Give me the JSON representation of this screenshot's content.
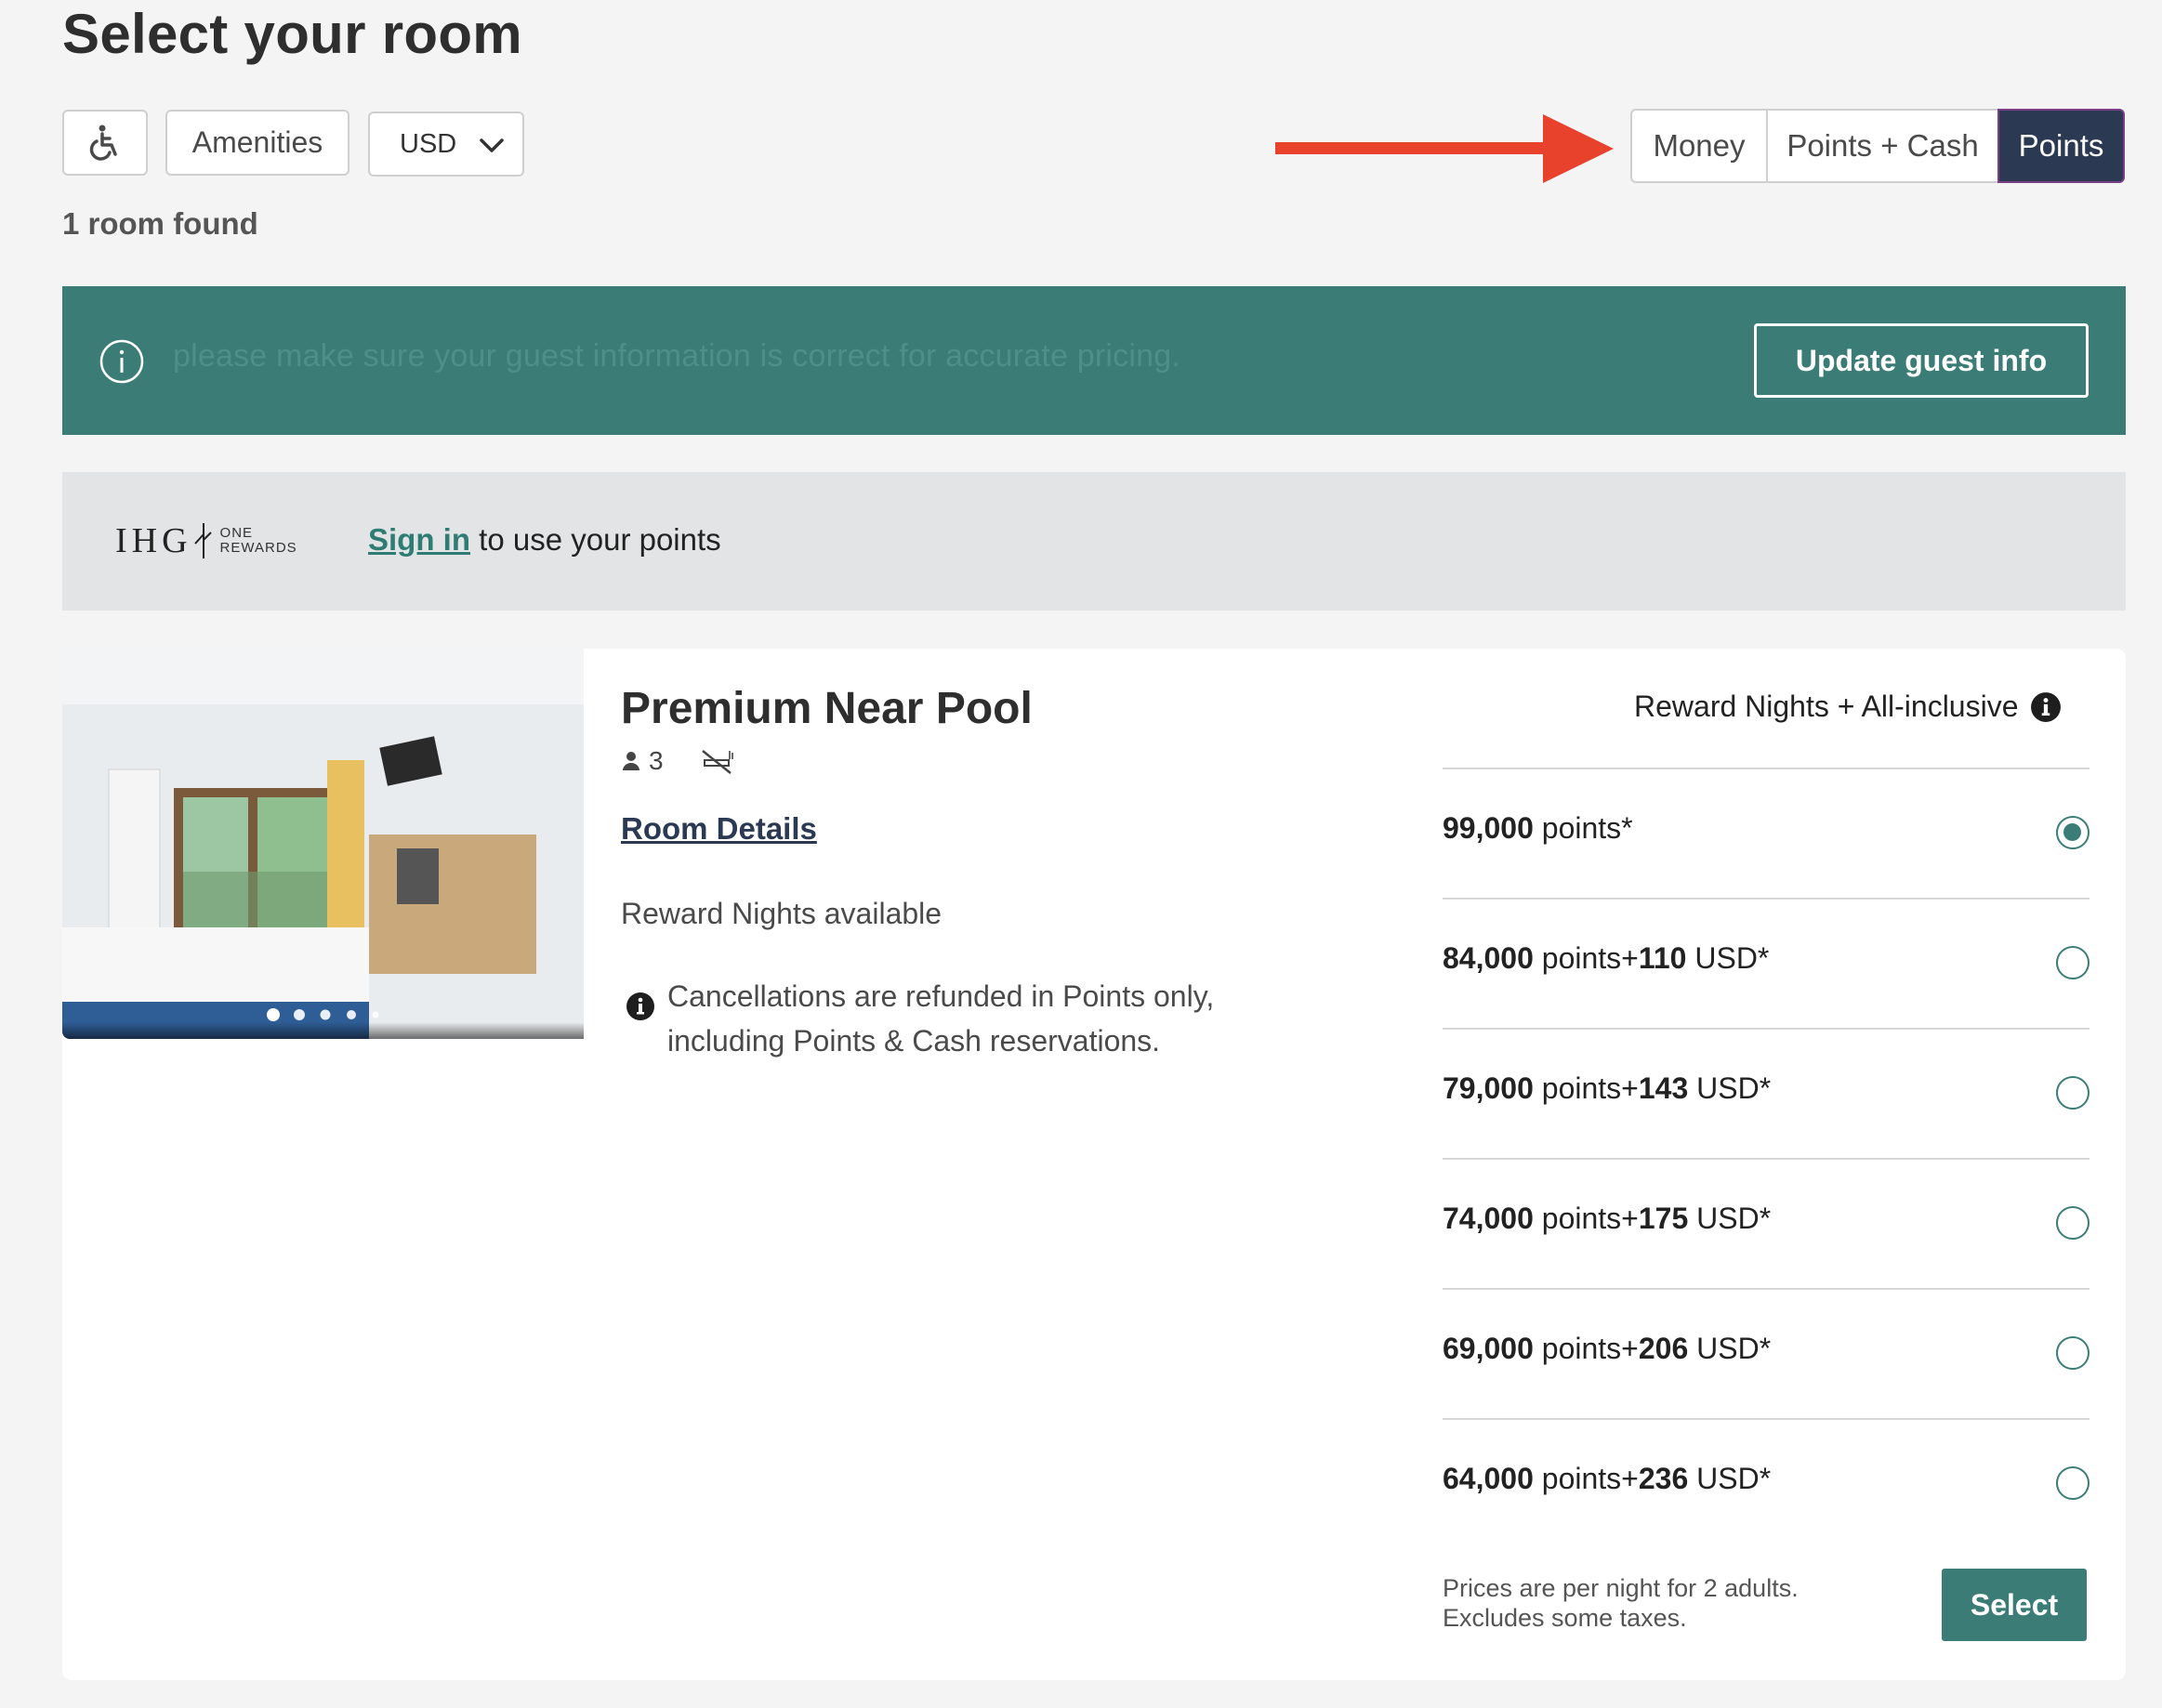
{
  "page": {
    "title": "Select your room"
  },
  "filters": {
    "accessibility_icon": "wheelchair-icon",
    "amenities_label": "Amenities",
    "currency": {
      "selected": "USD",
      "icon": "chevron-down-icon"
    }
  },
  "results": {
    "count_text": "1 room found"
  },
  "payment_toggle": {
    "options": [
      "Money",
      "Points + Cash",
      "Points"
    ],
    "selected": "Points"
  },
  "annotation": {
    "arrow_color": "#e8412c"
  },
  "info_banner": {
    "icon": "info-circle-icon",
    "text": "please make sure your guest information is correct for accurate pricing.",
    "button_label": "Update guest info",
    "background": "#3b7d76"
  },
  "loyalty_bar": {
    "logo": {
      "brand": "IHG",
      "line1": "ONE",
      "line2": "REWARDS"
    },
    "link_label": "Sign in",
    "trailing_text": "to use your points"
  },
  "room": {
    "name": "Premium Near Pool",
    "occupancy": "3",
    "occupancy_icon": "person-icon",
    "smoking_icon": "no-smoking-icon",
    "details_link": "Room Details",
    "availability": "Reward Nights available",
    "cancellation_note": "Cancellations are refunded in Points only, including Points & Cash reservations.",
    "photo_dots": 5,
    "rate_title": "Reward Nights + All-inclusive",
    "rates": [
      {
        "points": "99,000",
        "points_label": "points*",
        "plus": "",
        "cash": "",
        "currency": "",
        "selected": true
      },
      {
        "points": "84,000",
        "points_label": "points",
        "plus": "+",
        "cash": "110",
        "currency": "USD*",
        "selected": false
      },
      {
        "points": "79,000",
        "points_label": "points",
        "plus": "+",
        "cash": "143",
        "currency": "USD*",
        "selected": false
      },
      {
        "points": "74,000",
        "points_label": "points",
        "plus": "+",
        "cash": "175",
        "currency": "USD*",
        "selected": false
      },
      {
        "points": "69,000",
        "points_label": "points",
        "plus": "+",
        "cash": "206",
        "currency": "USD*",
        "selected": false
      },
      {
        "points": "64,000",
        "points_label": "points",
        "plus": "+",
        "cash": "236",
        "currency": "USD*",
        "selected": false
      }
    ],
    "price_note_line1": "Prices are per night for 2 adults.",
    "price_note_line2": "Excludes some taxes.",
    "select_label": "Select"
  },
  "colors": {
    "accent": "#3b7d76",
    "navy": "#2b3a52"
  }
}
